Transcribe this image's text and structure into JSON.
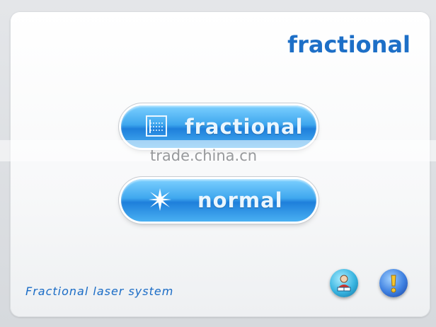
{
  "brand": {
    "title": "fractional"
  },
  "buttons": {
    "fractional_label": "fractional",
    "normal_label": "normal"
  },
  "footer": {
    "text": "Fractional laser system"
  },
  "watermark": {
    "text": "trade.china.cn"
  },
  "icons": {
    "fractional_mode": "ruler-grid-icon",
    "normal_mode": "starburst-icon",
    "user": "user-book-icon",
    "info": "exclamation-icon"
  },
  "colors": {
    "accent": "#1d6fc7",
    "button_top": "#7cd0ff",
    "button_bottom": "#1e7fdb"
  }
}
